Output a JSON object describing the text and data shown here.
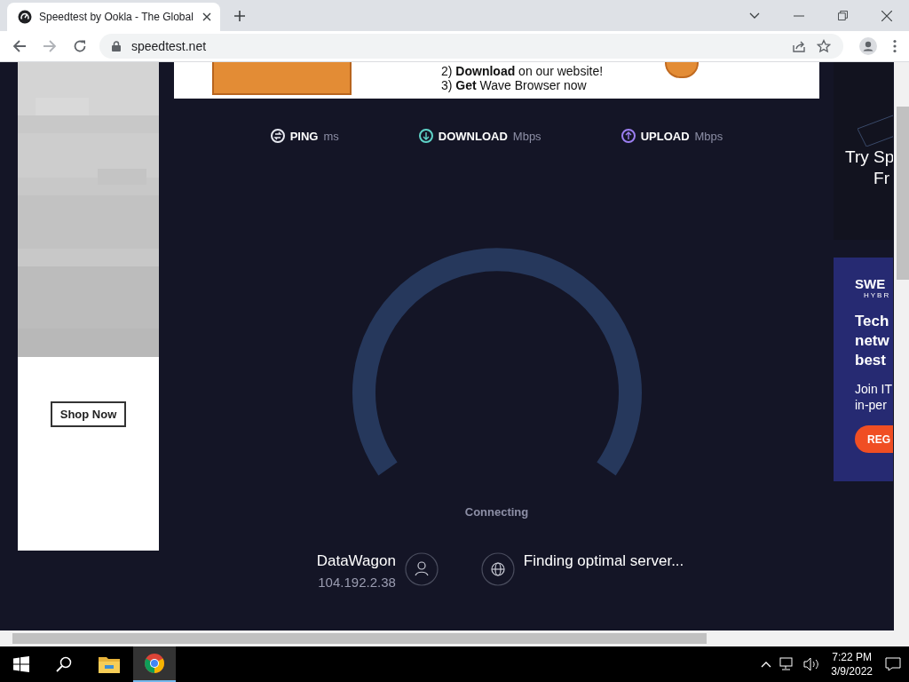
{
  "browser": {
    "tab_title": "Speedtest by Ookla - The Global",
    "url": "speedtest.net"
  },
  "ads": {
    "left": {
      "button": "Shop Now"
    },
    "top": {
      "lines": [
        "2)  **Download** on our website!",
        "3)  **Get** Wave Browser now"
      ]
    },
    "right_top": {
      "lines": [
        "Try Sp",
        "Fr"
      ]
    },
    "right": {
      "logo": "SWE",
      "logo_sub": "HYBR",
      "headline": [
        "Tech",
        "netw",
        "best"
      ],
      "body": [
        "Join IT",
        "in-per"
      ],
      "button": "REG"
    }
  },
  "speedtest": {
    "metrics": [
      {
        "kind": "ping",
        "label": "PING",
        "unit": "ms",
        "color": "#e6e8f0"
      },
      {
        "kind": "download",
        "label": "DOWNLOAD",
        "unit": "Mbps",
        "color": "#5fd3c8"
      },
      {
        "kind": "upload",
        "label": "UPLOAD",
        "unit": "Mbps",
        "color": "#9b7ef0"
      }
    ],
    "status": "Connecting",
    "provider": {
      "name": "DataWagon",
      "ip": "104.192.2.38"
    },
    "server_status": "Finding optimal server..."
  },
  "taskbar": {
    "time": "7:22 PM",
    "date": "3/9/2022"
  }
}
